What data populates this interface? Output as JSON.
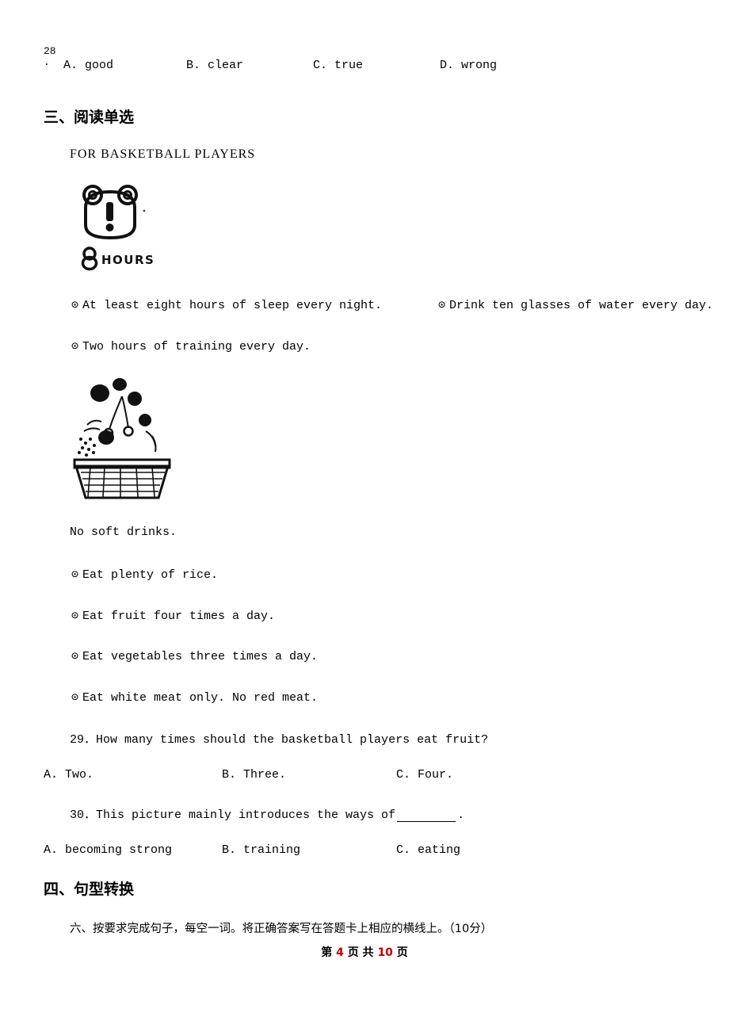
{
  "question28": {
    "number": "28\n.",
    "number_display": "28",
    "number_dot": ".",
    "options": [
      "A. good",
      "B. clear",
      "C. true",
      "D. wrong"
    ]
  },
  "section3": {
    "heading": "三、阅读单选"
  },
  "passage": {
    "title": "FOR BASKETBALL PLAYERS",
    "bullets_top_left": [
      "At least eight hours of sleep every night.",
      "Two hours of training every day."
    ],
    "bullets_top_right": [
      "Drink ten glasses of water every day."
    ],
    "plain_line": "No soft drinks.",
    "bullets_bottom": [
      "Eat plenty of rice.",
      "Eat fruit four times a day.",
      "Eat vegetables three times a day.",
      "Eat white meat only. No red meat."
    ],
    "bullet_symbol": "⊙",
    "koala_caption": "8 HOURS"
  },
  "question29": {
    "stem": "29．How many times should the basketball players eat fruit?",
    "options": [
      "A. Two.",
      "B. Three.",
      "C. Four."
    ]
  },
  "question30": {
    "stem_before": "30．This picture mainly introduces the ways of",
    "stem_after": ".",
    "options": [
      "A. becoming strong",
      "B. training",
      "C. eating"
    ]
  },
  "section4": {
    "heading": "四、句型转换",
    "instruction": "六、按要求完成句子，每空一词。将正确答案写在答题卡上相应的横线上。（10分）"
  },
  "footer": {
    "prefix": "第",
    "current_page": "4",
    "middle": "页 共",
    "total_pages": "10",
    "suffix": "页"
  },
  "colors": {
    "footer_accent": "#c00000",
    "text": "#000000",
    "background": "#ffffff"
  }
}
